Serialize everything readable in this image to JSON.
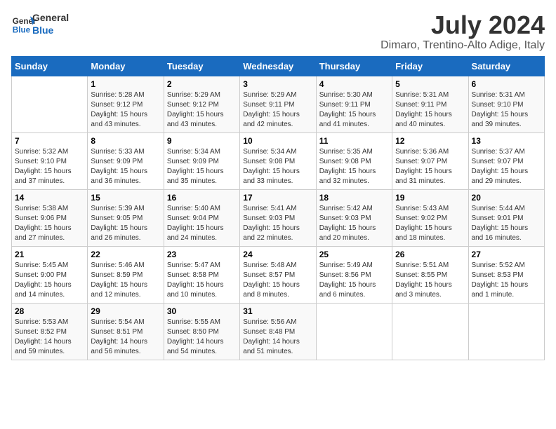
{
  "header": {
    "logo_line1": "General",
    "logo_line2": "Blue",
    "month": "July 2024",
    "location": "Dimaro, Trentino-Alto Adige, Italy"
  },
  "days_of_week": [
    "Sunday",
    "Monday",
    "Tuesday",
    "Wednesday",
    "Thursday",
    "Friday",
    "Saturday"
  ],
  "weeks": [
    [
      {
        "day": "",
        "content": ""
      },
      {
        "day": "1",
        "content": "Sunrise: 5:28 AM\nSunset: 9:12 PM\nDaylight: 15 hours\nand 43 minutes."
      },
      {
        "day": "2",
        "content": "Sunrise: 5:29 AM\nSunset: 9:12 PM\nDaylight: 15 hours\nand 43 minutes."
      },
      {
        "day": "3",
        "content": "Sunrise: 5:29 AM\nSunset: 9:11 PM\nDaylight: 15 hours\nand 42 minutes."
      },
      {
        "day": "4",
        "content": "Sunrise: 5:30 AM\nSunset: 9:11 PM\nDaylight: 15 hours\nand 41 minutes."
      },
      {
        "day": "5",
        "content": "Sunrise: 5:31 AM\nSunset: 9:11 PM\nDaylight: 15 hours\nand 40 minutes."
      },
      {
        "day": "6",
        "content": "Sunrise: 5:31 AM\nSunset: 9:10 PM\nDaylight: 15 hours\nand 39 minutes."
      }
    ],
    [
      {
        "day": "7",
        "content": "Sunrise: 5:32 AM\nSunset: 9:10 PM\nDaylight: 15 hours\nand 37 minutes."
      },
      {
        "day": "8",
        "content": "Sunrise: 5:33 AM\nSunset: 9:09 PM\nDaylight: 15 hours\nand 36 minutes."
      },
      {
        "day": "9",
        "content": "Sunrise: 5:34 AM\nSunset: 9:09 PM\nDaylight: 15 hours\nand 35 minutes."
      },
      {
        "day": "10",
        "content": "Sunrise: 5:34 AM\nSunset: 9:08 PM\nDaylight: 15 hours\nand 33 minutes."
      },
      {
        "day": "11",
        "content": "Sunrise: 5:35 AM\nSunset: 9:08 PM\nDaylight: 15 hours\nand 32 minutes."
      },
      {
        "day": "12",
        "content": "Sunrise: 5:36 AM\nSunset: 9:07 PM\nDaylight: 15 hours\nand 31 minutes."
      },
      {
        "day": "13",
        "content": "Sunrise: 5:37 AM\nSunset: 9:07 PM\nDaylight: 15 hours\nand 29 minutes."
      }
    ],
    [
      {
        "day": "14",
        "content": "Sunrise: 5:38 AM\nSunset: 9:06 PM\nDaylight: 15 hours\nand 27 minutes."
      },
      {
        "day": "15",
        "content": "Sunrise: 5:39 AM\nSunset: 9:05 PM\nDaylight: 15 hours\nand 26 minutes."
      },
      {
        "day": "16",
        "content": "Sunrise: 5:40 AM\nSunset: 9:04 PM\nDaylight: 15 hours\nand 24 minutes."
      },
      {
        "day": "17",
        "content": "Sunrise: 5:41 AM\nSunset: 9:03 PM\nDaylight: 15 hours\nand 22 minutes."
      },
      {
        "day": "18",
        "content": "Sunrise: 5:42 AM\nSunset: 9:03 PM\nDaylight: 15 hours\nand 20 minutes."
      },
      {
        "day": "19",
        "content": "Sunrise: 5:43 AM\nSunset: 9:02 PM\nDaylight: 15 hours\nand 18 minutes."
      },
      {
        "day": "20",
        "content": "Sunrise: 5:44 AM\nSunset: 9:01 PM\nDaylight: 15 hours\nand 16 minutes."
      }
    ],
    [
      {
        "day": "21",
        "content": "Sunrise: 5:45 AM\nSunset: 9:00 PM\nDaylight: 15 hours\nand 14 minutes."
      },
      {
        "day": "22",
        "content": "Sunrise: 5:46 AM\nSunset: 8:59 PM\nDaylight: 15 hours\nand 12 minutes."
      },
      {
        "day": "23",
        "content": "Sunrise: 5:47 AM\nSunset: 8:58 PM\nDaylight: 15 hours\nand 10 minutes."
      },
      {
        "day": "24",
        "content": "Sunrise: 5:48 AM\nSunset: 8:57 PM\nDaylight: 15 hours\nand 8 minutes."
      },
      {
        "day": "25",
        "content": "Sunrise: 5:49 AM\nSunset: 8:56 PM\nDaylight: 15 hours\nand 6 minutes."
      },
      {
        "day": "26",
        "content": "Sunrise: 5:51 AM\nSunset: 8:55 PM\nDaylight: 15 hours\nand 3 minutes."
      },
      {
        "day": "27",
        "content": "Sunrise: 5:52 AM\nSunset: 8:53 PM\nDaylight: 15 hours\nand 1 minute."
      }
    ],
    [
      {
        "day": "28",
        "content": "Sunrise: 5:53 AM\nSunset: 8:52 PM\nDaylight: 14 hours\nand 59 minutes."
      },
      {
        "day": "29",
        "content": "Sunrise: 5:54 AM\nSunset: 8:51 PM\nDaylight: 14 hours\nand 56 minutes."
      },
      {
        "day": "30",
        "content": "Sunrise: 5:55 AM\nSunset: 8:50 PM\nDaylight: 14 hours\nand 54 minutes."
      },
      {
        "day": "31",
        "content": "Sunrise: 5:56 AM\nSunset: 8:48 PM\nDaylight: 14 hours\nand 51 minutes."
      },
      {
        "day": "",
        "content": ""
      },
      {
        "day": "",
        "content": ""
      },
      {
        "day": "",
        "content": ""
      }
    ]
  ]
}
